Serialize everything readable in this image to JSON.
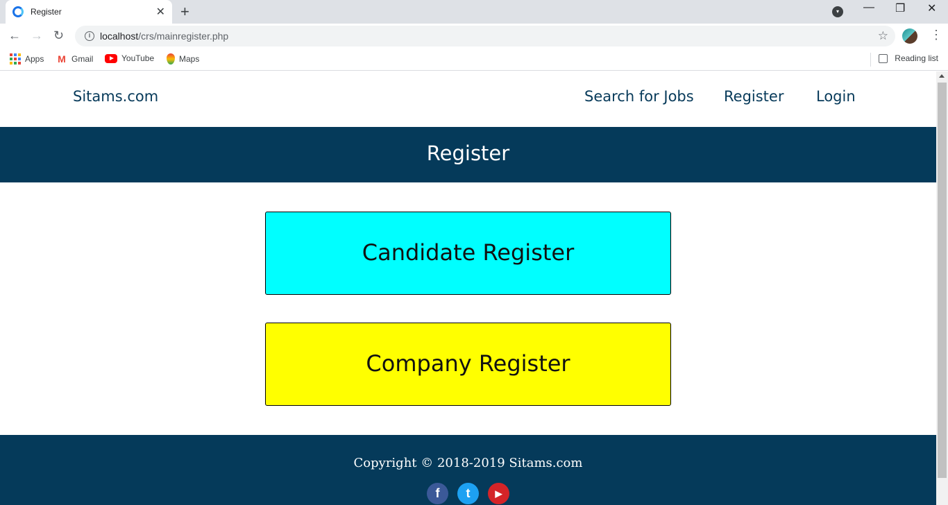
{
  "browser": {
    "tab_title": "Register",
    "url_host": "localhost",
    "url_path": "/crs/mainregister.php",
    "bookmarks": [
      {
        "label": "Apps",
        "icon": "apps-grid-icon"
      },
      {
        "label": "Gmail",
        "icon": "gmail-icon"
      },
      {
        "label": "YouTube",
        "icon": "youtube-icon"
      },
      {
        "label": "Maps",
        "icon": "maps-icon"
      }
    ],
    "reading_list": "Reading list"
  },
  "site": {
    "brand": "Sitams.com",
    "nav": [
      {
        "label": "Search for Jobs"
      },
      {
        "label": "Register"
      },
      {
        "label": "Login"
      }
    ],
    "banner_title": "Register",
    "buttons": [
      {
        "label": "Candidate Register",
        "color": "#00ffff"
      },
      {
        "label": "Company Register",
        "color": "#ffff00"
      }
    ],
    "footer": {
      "copyright": "Copyright © 2018-2019 Sitams.com",
      "social": [
        {
          "icon": "facebook-icon",
          "glyph": "f",
          "color": "#3b5998"
        },
        {
          "icon": "twitter-icon",
          "glyph": "t",
          "color": "#1da1f2"
        },
        {
          "icon": "youtube-icon",
          "glyph": "▶",
          "color": "#d42428"
        }
      ]
    },
    "colors": {
      "primary": "#053a5a",
      "text": "#073a5a"
    }
  }
}
